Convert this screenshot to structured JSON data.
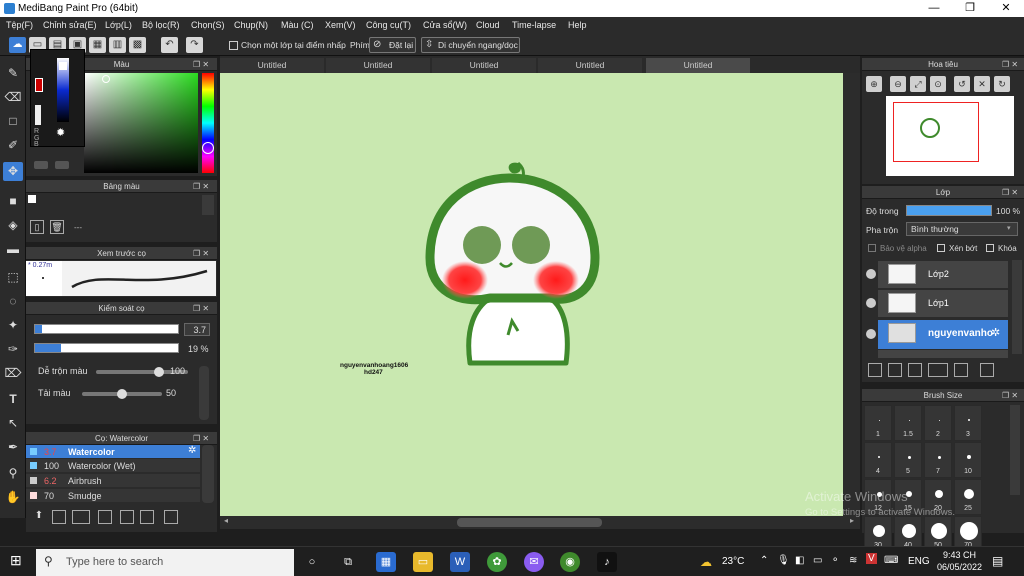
{
  "window": {
    "title": "MediBang Paint Pro (64bit)",
    "controls": [
      "—",
      "❐",
      "✕"
    ]
  },
  "menu": [
    "Tệp(F)",
    "Chỉnh sửa(E)",
    "Lớp(L)",
    "Bộ lọc(R)",
    "Chọn(S)",
    "Chụp(N)",
    "Màu (C)",
    "Xem(V)",
    "Công cụ(T)",
    "Cửa sổ(W)",
    "Cloud",
    "Time-lapse",
    "Help"
  ],
  "toolbar": {
    "checkbox_label": "Chọn một lớp tại điểm nhấp",
    "phim_label": "Phím",
    "reset_label": "Đặt lại",
    "move_label": "Di chuyển ngang/dọc"
  },
  "panels": {
    "color": {
      "title": "Màu",
      "rgb_letters": [
        "R",
        "G",
        "B",
        "#"
      ]
    },
    "palette": {
      "title": "Bảng màu",
      "dash": "---"
    },
    "brush_preview": {
      "title": "Xem trước cọ",
      "size_text": "* 0.27m"
    },
    "brush_control": {
      "title": "Kiểm soát cọ",
      "size_value": "3.7",
      "opacity_value": "19 %",
      "blend_label": "Dễ trộn màu",
      "blend_value": "100",
      "amount_label": "Tải màu",
      "amount_value": "50"
    },
    "brush_list": {
      "title": "Cọ: Watercolor",
      "items": [
        {
          "size": "3.7",
          "name": "Watercolor",
          "selected": true
        },
        {
          "size": "100",
          "name": "Watercolor (Wet)",
          "selected": false
        },
        {
          "size": "6.2",
          "name": "Airbrush",
          "selected": false
        },
        {
          "size": "70",
          "name": "Smudge",
          "selected": false
        }
      ]
    },
    "navigator": {
      "title": "Hoa tiêu"
    },
    "layer": {
      "title": "Lớp",
      "opacity_label": "Độ trong",
      "opacity_value": "100 %",
      "blend_label": "Pha trộn",
      "blend_value": "Bình thường",
      "protect_alpha": "Bảo vệ alpha",
      "clipping": "Xén bớt",
      "lock": "Khóa",
      "layers": [
        {
          "name": "Lớp2",
          "selected": false
        },
        {
          "name": "Lớp1",
          "selected": false
        },
        {
          "name": "nguyenvanho",
          "selected": true
        }
      ]
    },
    "brush_size": {
      "title": "Brush Size",
      "sizes": [
        "1",
        "1.5",
        "2",
        "3",
        "4",
        "5",
        "7",
        "10",
        "12",
        "15",
        "20",
        "25",
        "30",
        "40",
        "50",
        "70"
      ]
    }
  },
  "tabs": [
    "Untitled",
    "Untitled",
    "Untitled",
    "Untitled",
    "Untitled"
  ],
  "canvas": {
    "signature_line1": "nguyenvanhoang1606",
    "signature_line2": "hd247",
    "background_color": "#c9e8b0"
  },
  "watermark": {
    "line1": "Activate Windows",
    "line2": "Go to Settings to activate Windows."
  },
  "taskbar": {
    "search_placeholder": "Type here to search",
    "weather": "23°C",
    "lang": "ENG",
    "time": "9:43 CH",
    "date": "06/05/2022"
  },
  "colors": {
    "accent": "#3d7fd6",
    "canvas_bg": "#c9e8b0",
    "character_outline": "#4c8a34",
    "blush": "#ff2a2a"
  }
}
